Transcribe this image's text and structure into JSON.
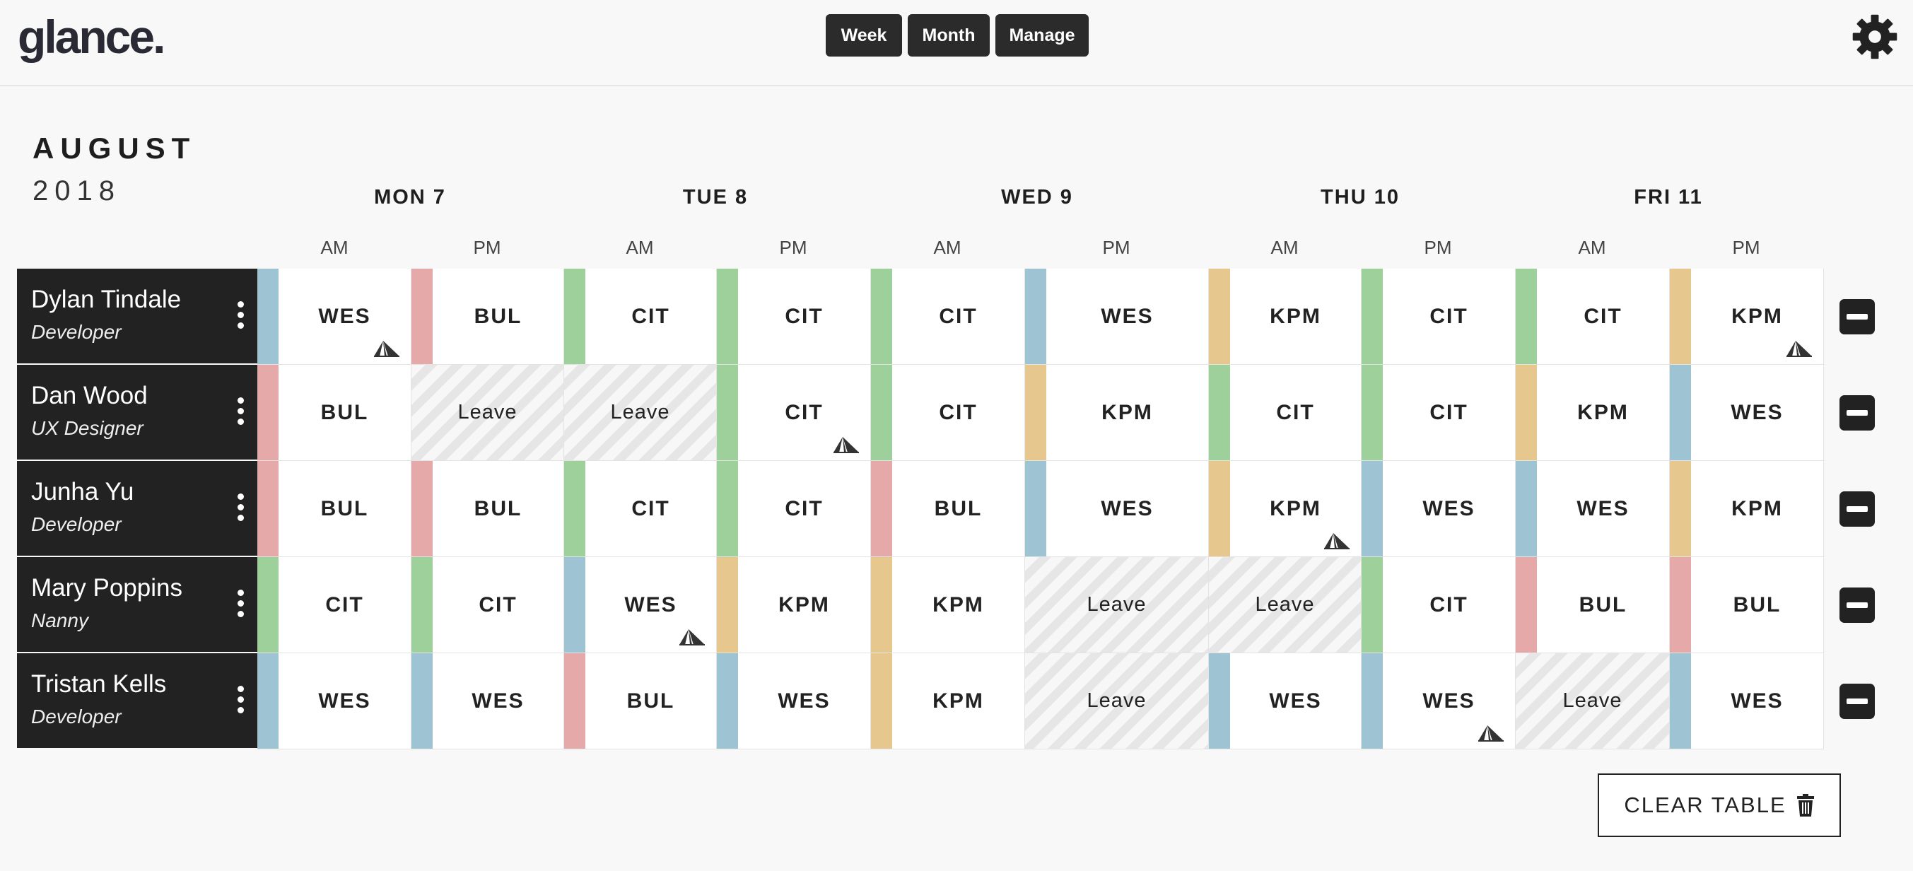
{
  "app": {
    "logo": "glance."
  },
  "nav": {
    "week": "Week",
    "month": "Month",
    "manage": "Manage"
  },
  "header": {
    "month": "AUGUST",
    "year": "2018"
  },
  "days": [
    {
      "label": "MON 7",
      "am": "AM",
      "pm": "PM"
    },
    {
      "label": "TUE 8",
      "am": "AM",
      "pm": "PM"
    },
    {
      "label": "WED 9",
      "am": "AM",
      "pm": "PM"
    },
    {
      "label": "THU 10",
      "am": "AM",
      "pm": "PM"
    },
    {
      "label": "FRI 11",
      "am": "AM",
      "pm": "PM"
    }
  ],
  "colors": {
    "WES": "#9ec3d3",
    "BUL": "#e6a9aa",
    "CIT": "#9ed09c",
    "KPM": "#e6c78e",
    "header_dark": "#222222"
  },
  "people": [
    {
      "name": "Dylan Tindale",
      "role": "Developer",
      "slots": [
        {
          "code": "WES",
          "tent": true
        },
        {
          "code": "BUL"
        },
        {
          "code": "CIT"
        },
        {
          "code": "CIT"
        },
        {
          "code": "CIT"
        },
        {
          "code": "WES"
        },
        {
          "code": "KPM"
        },
        {
          "code": "CIT"
        },
        {
          "code": "CIT"
        },
        {
          "code": "KPM",
          "tent": true
        }
      ]
    },
    {
      "name": "Dan Wood",
      "role": "UX Designer",
      "slots": [
        {
          "code": "BUL"
        },
        {
          "code": "Leave",
          "leave": true
        },
        {
          "code": "Leave",
          "leave": true
        },
        {
          "code": "CIT",
          "tent": true
        },
        {
          "code": "CIT"
        },
        {
          "code": "KPM"
        },
        {
          "code": "CIT"
        },
        {
          "code": "CIT"
        },
        {
          "code": "KPM"
        },
        {
          "code": "WES"
        }
      ]
    },
    {
      "name": "Junha Yu",
      "role": "Developer",
      "slots": [
        {
          "code": "BUL"
        },
        {
          "code": "BUL"
        },
        {
          "code": "CIT"
        },
        {
          "code": "CIT"
        },
        {
          "code": "BUL"
        },
        {
          "code": "WES"
        },
        {
          "code": "KPM",
          "tent": true
        },
        {
          "code": "WES"
        },
        {
          "code": "WES"
        },
        {
          "code": "KPM"
        }
      ]
    },
    {
      "name": "Mary Poppins",
      "role": "Nanny",
      "slots": [
        {
          "code": "CIT"
        },
        {
          "code": "CIT"
        },
        {
          "code": "WES",
          "tent": true
        },
        {
          "code": "KPM"
        },
        {
          "code": "KPM"
        },
        {
          "code": "Leave",
          "leave": true
        },
        {
          "code": "Leave",
          "leave": true
        },
        {
          "code": "CIT"
        },
        {
          "code": "BUL"
        },
        {
          "code": "BUL"
        }
      ]
    },
    {
      "name": "Tristan Kells",
      "role": "Developer",
      "slots": [
        {
          "code": "WES"
        },
        {
          "code": "WES"
        },
        {
          "code": "BUL"
        },
        {
          "code": "WES"
        },
        {
          "code": "KPM"
        },
        {
          "code": "Leave",
          "leave": true
        },
        {
          "code": "WES"
        },
        {
          "code": "WES",
          "tent": true
        },
        {
          "code": "Leave",
          "leave": true
        },
        {
          "code": "WES"
        }
      ]
    }
  ],
  "actions": {
    "clear_table": "CLEAR TABLE"
  }
}
